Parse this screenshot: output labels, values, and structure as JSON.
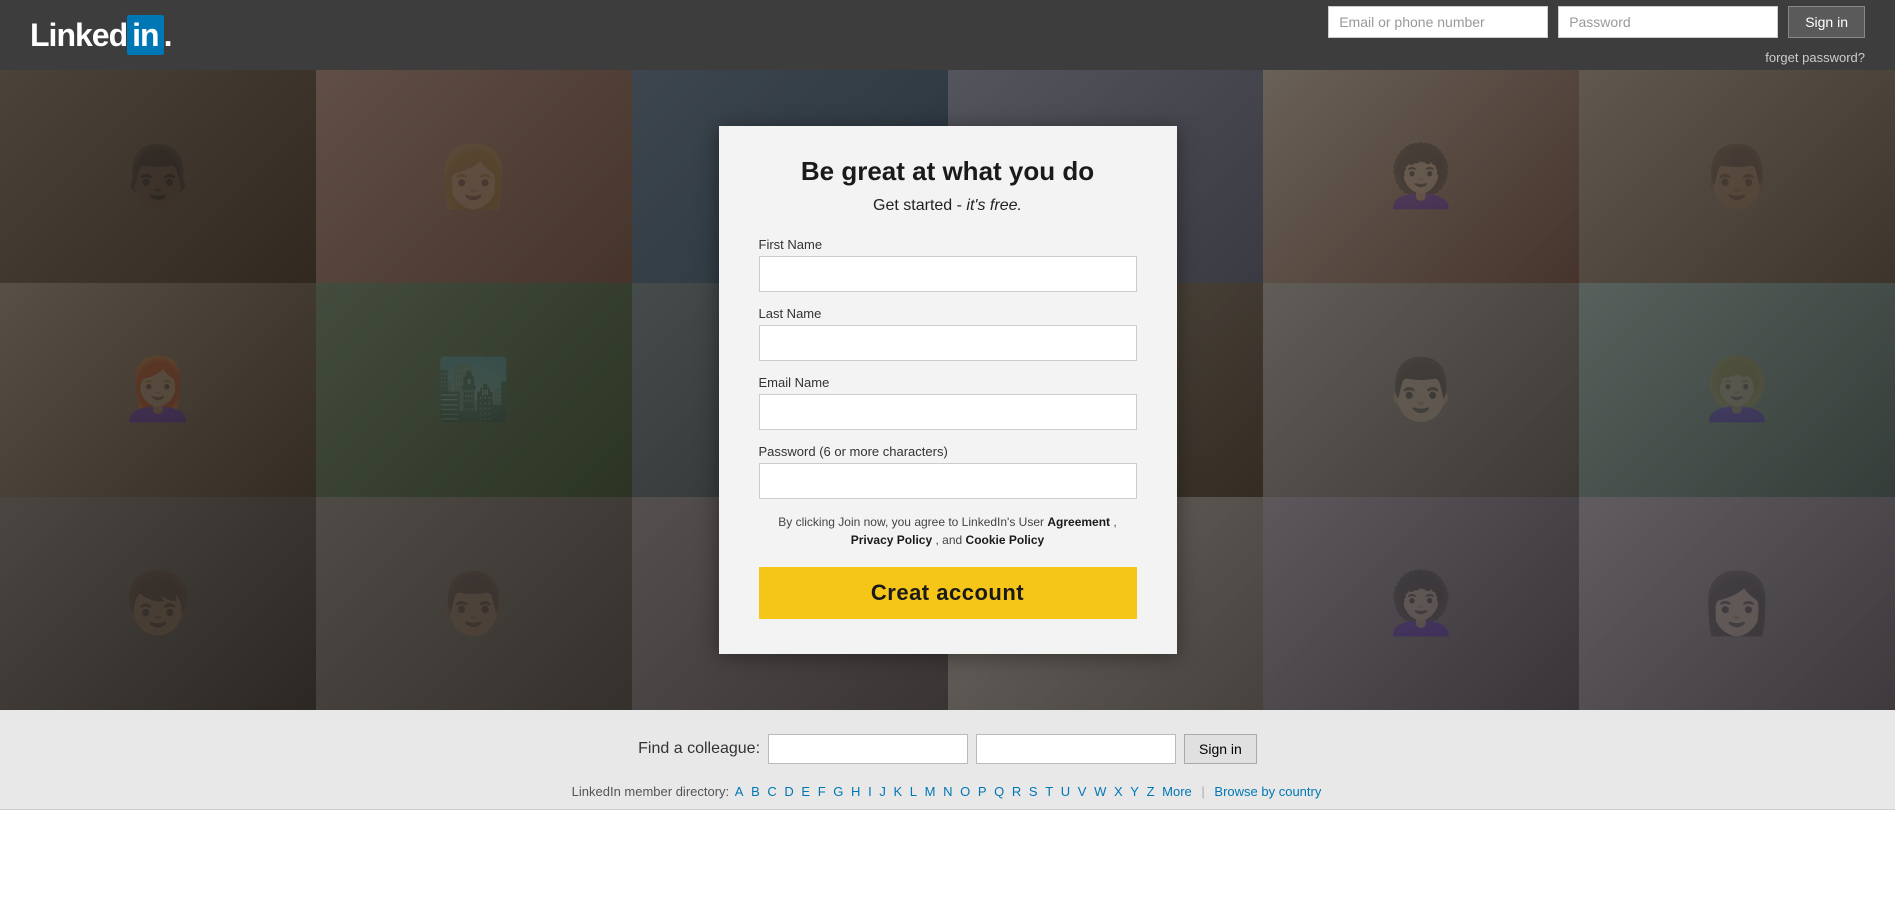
{
  "header": {
    "logo_linked": "Linked",
    "logo_in": "in",
    "logo_dot": ".",
    "email_placeholder": "Email or phone number",
    "password_placeholder": "Password",
    "sign_in_label": "Sign in",
    "forgot_password_label": "forget password?"
  },
  "modal": {
    "title": "Be great at what you do",
    "subtitle_part1": "Get started -",
    "subtitle_part2": "it's free.",
    "first_name_label": "First Name",
    "last_name_label": "Last Name",
    "email_label": "Email Name",
    "password_label": "Password (6 or more characters)",
    "terms_text_1": "By clicking Join now, you agree to LinkedIn's User",
    "terms_agreement": "Agreement",
    "terms_text_2": ",",
    "terms_privacy": "Privacy Policy",
    "terms_text_3": ", and",
    "terms_cookie": "Cookie Policy",
    "create_account_label": "Creat account"
  },
  "footer": {
    "find_colleague_label": "Find a colleague:",
    "sign_in_label": "Sign in",
    "directory_label": "LinkedIn member directory:",
    "letters": [
      "A",
      "B",
      "C",
      "D",
      "E",
      "F",
      "G",
      "H",
      "I",
      "J",
      "K",
      "L",
      "M",
      "N",
      "O",
      "P",
      "Q",
      "R",
      "S",
      "T",
      "U",
      "V",
      "W",
      "X",
      "Y",
      "Z"
    ],
    "more_label": "More",
    "browse_country_label": "Browse by country"
  }
}
